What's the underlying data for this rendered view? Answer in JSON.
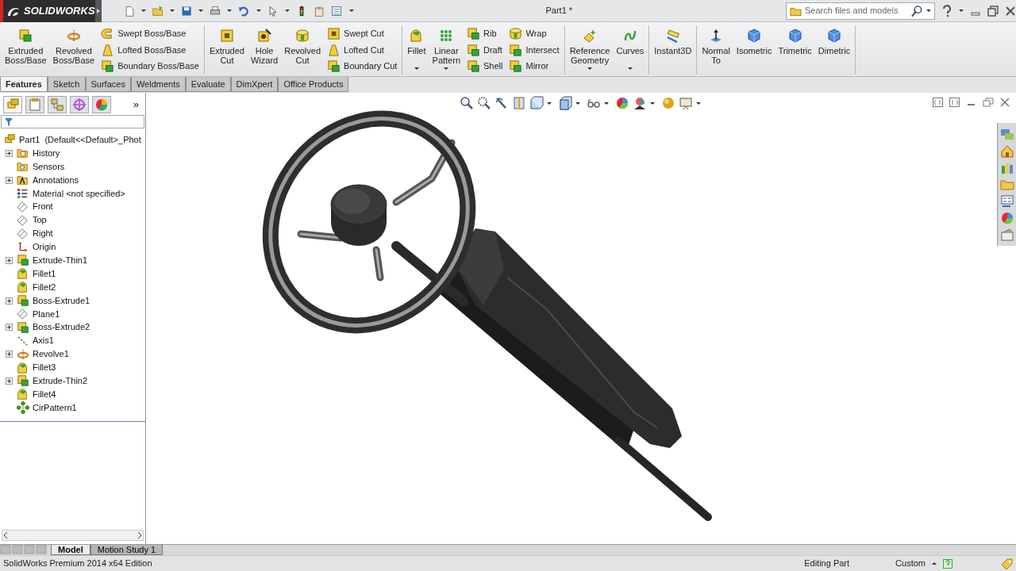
{
  "app": {
    "brand": "SOLIDWORKS",
    "title": "Part1 *",
    "search": {
      "placeholder": "Search files and models"
    }
  },
  "ribbon": [
    {
      "items": [
        {
          "kind": "large",
          "label": "Extruded\nBoss/Base",
          "dropdown": false
        },
        {
          "kind": "large",
          "label": "Revolved\nBoss/Base",
          "dropdown": false
        },
        {
          "kind": "stack",
          "items": [
            {
              "label": "Swept Boss/Base"
            },
            {
              "label": "Lofted Boss/Base"
            },
            {
              "label": "Boundary Boss/Base"
            }
          ]
        }
      ]
    },
    {
      "items": [
        {
          "kind": "large",
          "label": "Extruded\nCut",
          "dropdown": false
        },
        {
          "kind": "large",
          "label": "Hole\nWizard",
          "dropdown": false
        },
        {
          "kind": "large",
          "label": "Revolved\nCut",
          "dropdown": false
        },
        {
          "kind": "stack",
          "items": [
            {
              "label": "Swept Cut"
            },
            {
              "label": "Lofted Cut"
            },
            {
              "label": "Boundary Cut"
            }
          ]
        }
      ]
    },
    {
      "items": [
        {
          "kind": "large",
          "label": "Fillet",
          "dropdown": true
        },
        {
          "kind": "large",
          "label": "Linear\nPattern",
          "dropdown": true
        },
        {
          "kind": "stack",
          "items": [
            {
              "label": "Rib"
            },
            {
              "label": "Draft"
            },
            {
              "label": "Shell"
            }
          ]
        },
        {
          "kind": "stack",
          "items": [
            {
              "label": "Wrap"
            },
            {
              "label": "Intersect"
            },
            {
              "label": "Mirror"
            }
          ]
        }
      ]
    },
    {
      "items": [
        {
          "kind": "large",
          "label": "Reference\nGeometry",
          "dropdown": true
        },
        {
          "kind": "large",
          "label": "Curves",
          "dropdown": true
        }
      ]
    },
    {
      "items": [
        {
          "kind": "large",
          "label": "Instant3D",
          "dropdown": false
        }
      ]
    },
    {
      "items": [
        {
          "kind": "large",
          "label": "Normal\nTo",
          "dropdown": false
        },
        {
          "kind": "large",
          "label": "Isometric",
          "dropdown": false
        },
        {
          "kind": "large",
          "label": "Trimetric",
          "dropdown": false
        },
        {
          "kind": "large",
          "label": "Dimetric",
          "dropdown": false
        }
      ]
    }
  ],
  "command_tabs": [
    {
      "label": "Features",
      "selected": true
    },
    {
      "label": "Sketch",
      "selected": false
    },
    {
      "label": "Surfaces",
      "selected": false
    },
    {
      "label": "Weldments",
      "selected": false
    },
    {
      "label": "Evaluate",
      "selected": false
    },
    {
      "label": "DimXpert",
      "selected": false
    },
    {
      "label": "Office Products",
      "selected": false
    }
  ],
  "panel_tabs": [
    {
      "selected": true
    },
    {
      "selected": false
    },
    {
      "selected": false
    },
    {
      "selected": false
    },
    {
      "selected": false
    }
  ],
  "panel_more": "»",
  "tree": {
    "root": {
      "label": "Part1  (Default<<Default>_Phot"
    },
    "items": [
      {
        "label": "History",
        "kind": "history",
        "expandable": true
      },
      {
        "label": "Sensors",
        "kind": "sensors",
        "expandable": false
      },
      {
        "label": "Annotations",
        "kind": "annotations",
        "expandable": true
      },
      {
        "label": "Material <not specified>",
        "kind": "material",
        "expandable": false
      },
      {
        "label": "Front",
        "kind": "plane",
        "expandable": false
      },
      {
        "label": "Top",
        "kind": "plane",
        "expandable": false
      },
      {
        "label": "Right",
        "kind": "plane",
        "expandable": false
      },
      {
        "label": "Origin",
        "kind": "origin",
        "expandable": false
      },
      {
        "label": "Extrude-Thin1",
        "kind": "extrude",
        "expandable": true
      },
      {
        "label": "Fillet1",
        "kind": "fillet",
        "expandable": false
      },
      {
        "label": "Fillet2",
        "kind": "fillet",
        "expandable": false
      },
      {
        "label": "Boss-Extrude1",
        "kind": "extrude",
        "expandable": true
      },
      {
        "label": "Plane1",
        "kind": "plane",
        "expandable": false
      },
      {
        "label": "Boss-Extrude2",
        "kind": "extrude",
        "expandable": true
      },
      {
        "label": "Axis1",
        "kind": "axis",
        "expandable": false
      },
      {
        "label": "Revolve1",
        "kind": "revolve",
        "expandable": true
      },
      {
        "label": "Fillet3",
        "kind": "fillet",
        "expandable": false
      },
      {
        "label": "Extrude-Thin2",
        "kind": "extrude",
        "expandable": true
      },
      {
        "label": "Fillet4",
        "kind": "fillet",
        "expandable": false
      },
      {
        "label": "CirPattern1",
        "kind": "pattern",
        "expandable": false
      }
    ]
  },
  "bottom_tabs": [
    {
      "label": "Model",
      "selected": true
    },
    {
      "label": "Motion Study 1",
      "selected": false
    }
  ],
  "status_bar": {
    "edition": "SolidWorks Premium 2014 x64 Edition",
    "mode": "Editing Part",
    "units": "Custom"
  }
}
